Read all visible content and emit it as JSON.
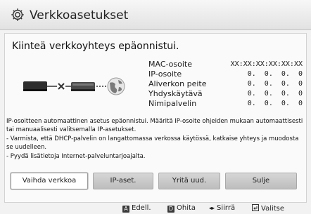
{
  "header": {
    "title": "Verkkoasetukset",
    "icon": "gear-icon"
  },
  "panel": {
    "error_title": "Kiinteä verkkoyhteys epäonnistui.",
    "info": [
      {
        "label": "MAC-osoite",
        "value": "XX:XX:XX:XX:XX:XX"
      },
      {
        "label": "IP-osoite",
        "value": "0.  0.  0.  0"
      },
      {
        "label": "Aliverkon peite",
        "value": "0.  0.  0.  0"
      },
      {
        "label": "Yhdyskäytävä",
        "value": "0.  0.  0.  0"
      },
      {
        "label": "Nimipalvelin",
        "value": "0.  0.  0.  0"
      }
    ],
    "message": [
      "IP-osoitteen automaattinen asetus epäonnistui. Määritä IP-osoite ohjeiden mukaan automaattisesti tai manuaalisesti valitsemalla IP-asetukset.",
      "- Varmista, että DHCP-palvelin on langattomassa verkossa käytössä, katkaise yhteys ja muodosta se uudelleen.",
      "- Pyydä lisätietoja Internet-palveluntarjoajalta."
    ]
  },
  "buttons": [
    {
      "label": "Vaihda verkkoa",
      "focused": true
    },
    {
      "label": "IP-aset.",
      "focused": false
    },
    {
      "label": "Yritä uud.",
      "focused": false
    },
    {
      "label": "Sulje",
      "focused": false
    }
  ],
  "footer": {
    "hints": [
      {
        "key": "A",
        "label": "Edell."
      },
      {
        "key": "D",
        "label": "Ohita"
      },
      {
        "key": "arrows-left-right-icon",
        "label": "Siirrä"
      },
      {
        "key": "return-icon",
        "label": "Valitse"
      }
    ]
  },
  "colors": {
    "key_bg": "#3a3a3a",
    "error_mark": "#333333"
  }
}
